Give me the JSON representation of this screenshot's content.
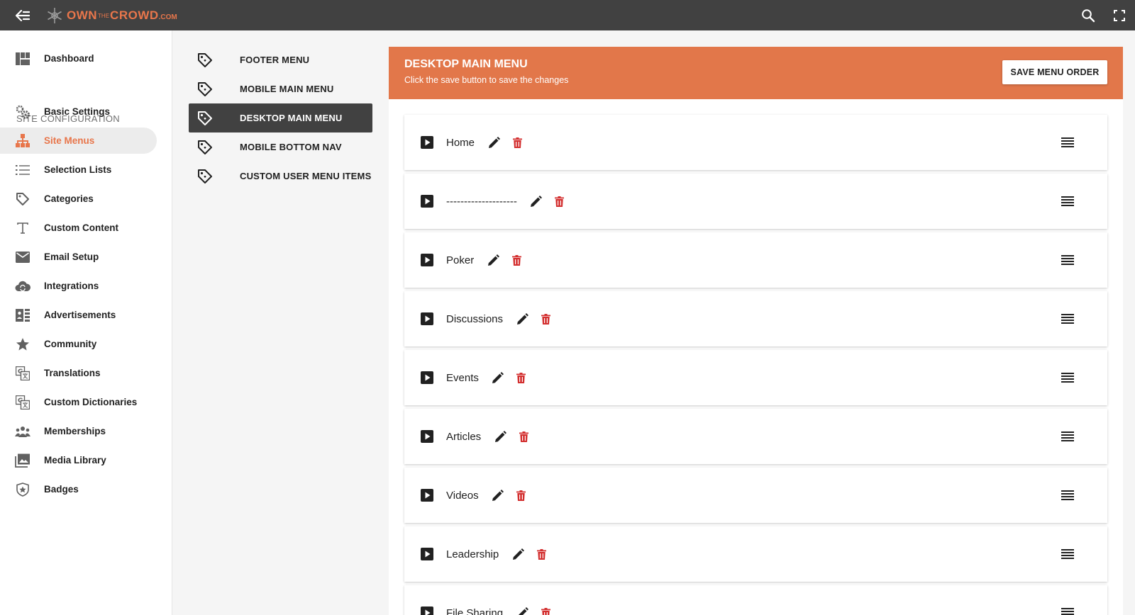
{
  "brand": {
    "part1": "OWN",
    "part2": "THE",
    "part3": "CROWD",
    "part4": ".COM",
    "accent": "#e8764b"
  },
  "topbar": {
    "icons": [
      "back-arrow-icon",
      "search-icon",
      "fullscreen-icon"
    ],
    "bg": "#414141"
  },
  "sidebar": {
    "section_label": "SITE CONFIGURATION",
    "items": [
      {
        "label": "Dashboard",
        "icon": "dashboard-icon"
      },
      {
        "label": "Basic Settings",
        "icon": "gears-icon"
      },
      {
        "label": "Site Menus",
        "icon": "sitemap-icon",
        "active": true
      },
      {
        "label": "Selection Lists",
        "icon": "list-icon"
      },
      {
        "label": "Categories",
        "icon": "tag-icon"
      },
      {
        "label": "Custom Content",
        "icon": "text-icon"
      },
      {
        "label": "Email Setup",
        "icon": "email-icon"
      },
      {
        "label": "Integrations",
        "icon": "cloud-sync-icon"
      },
      {
        "label": "Advertisements",
        "icon": "ad-icon"
      },
      {
        "label": "Community",
        "icon": "star-icon"
      },
      {
        "label": "Translations",
        "icon": "translate-icon"
      },
      {
        "label": "Custom Dictionaries",
        "icon": "translate-icon"
      },
      {
        "label": "Memberships",
        "icon": "group-icon"
      },
      {
        "label": "Media Library",
        "icon": "photo-library-icon"
      },
      {
        "label": "Badges",
        "icon": "badge-icon"
      }
    ]
  },
  "submenu": {
    "items": [
      {
        "label": "FOOTER MENU"
      },
      {
        "label": "MOBILE MAIN MENU"
      },
      {
        "label": "DESKTOP MAIN MENU",
        "active": true
      },
      {
        "label": "MOBILE BOTTOM NAV"
      },
      {
        "label": "CUSTOM USER MENU ITEMS"
      }
    ]
  },
  "panel": {
    "title": "DESKTOP MAIN MENU",
    "subtitle": "Click the save button to save the changes",
    "save_label": "SAVE MENU ORDER",
    "header_color": "#e2774a",
    "delete_color": "#d32f2f",
    "items": [
      {
        "label": "Home"
      },
      {
        "label": "--------------------"
      },
      {
        "label": "Poker"
      },
      {
        "label": "Discussions"
      },
      {
        "label": "Events"
      },
      {
        "label": "Articles"
      },
      {
        "label": "Videos"
      },
      {
        "label": "Leadership"
      },
      {
        "label": "File Sharing"
      }
    ]
  }
}
